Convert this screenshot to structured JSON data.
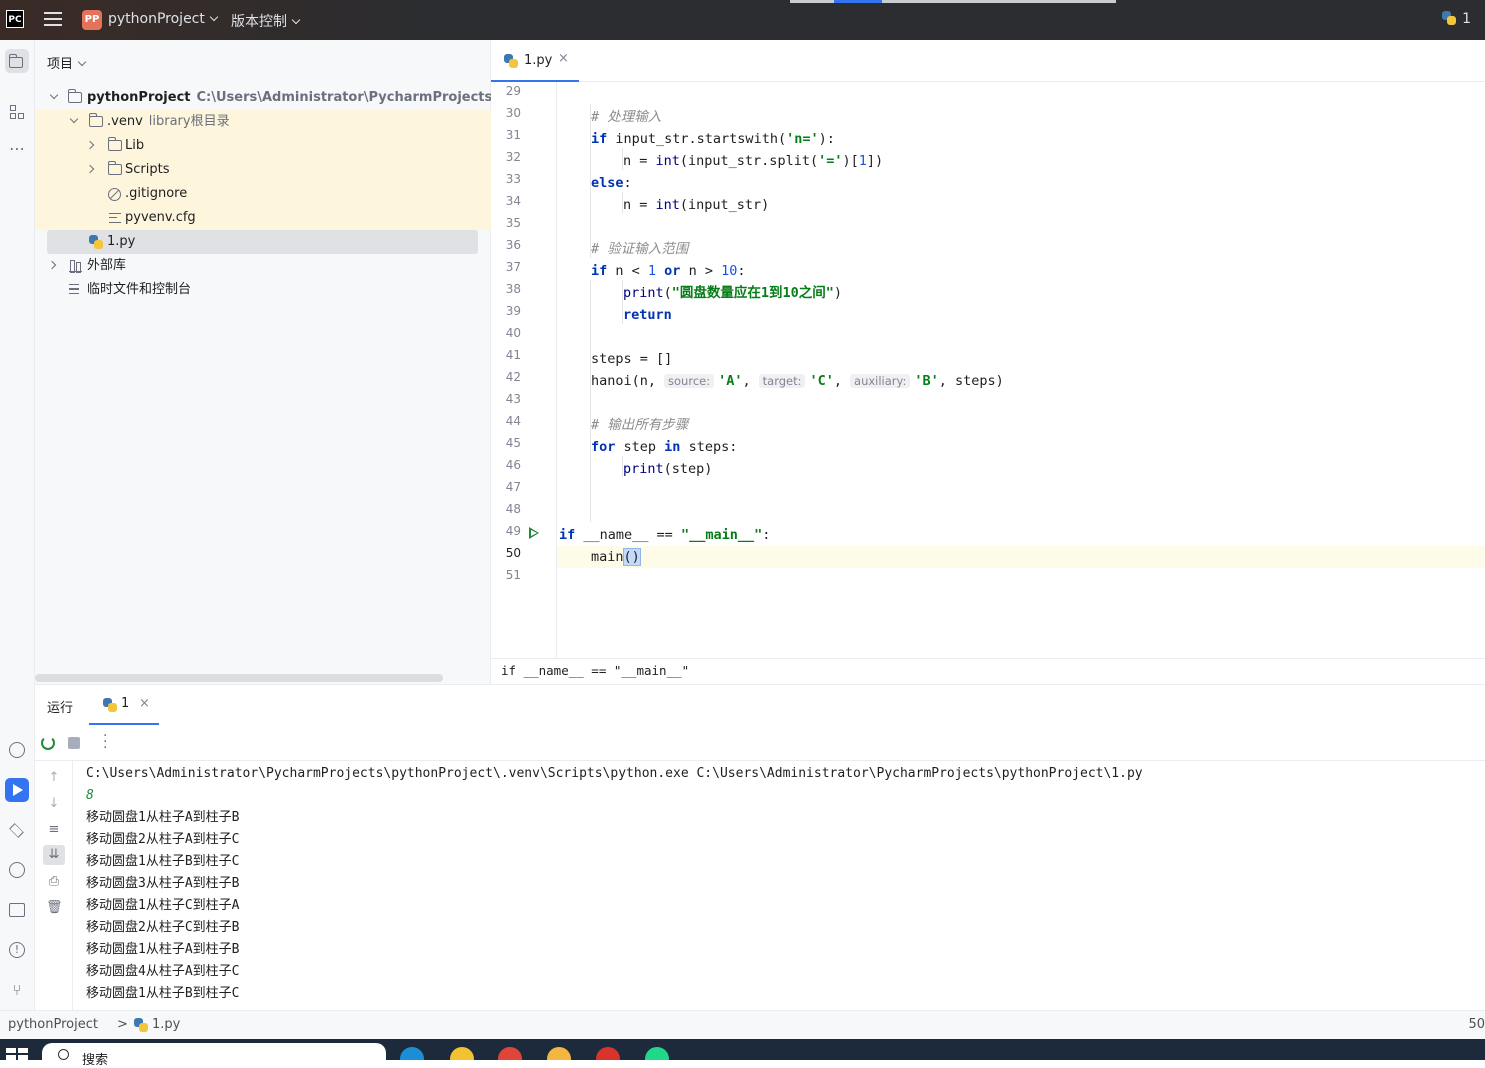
{
  "titlebar": {
    "app_logo": "PC",
    "project_badge": "PP",
    "project_name": "pythonProject",
    "vcs_label": "版本控制",
    "right_indicator": "1",
    "icons": [
      "pycharm-logo-icon",
      "hamburger-menu-icon",
      "chevron-down-icon",
      "python-icon"
    ]
  },
  "project_panel": {
    "title": "项目",
    "tree": [
      {
        "label": "pythonProject",
        "hint": "C:\\Users\\Administrator\\PycharmProjects\\pythonP",
        "icon": "folder-icon",
        "expanded": true
      },
      {
        "label": ".venv",
        "hint": "library根目录",
        "icon": "folder-icon",
        "expanded": true
      },
      {
        "label": "Lib",
        "icon": "folder-icon",
        "expanded": false
      },
      {
        "label": "Scripts",
        "icon": "folder-icon",
        "expanded": false
      },
      {
        "label": ".gitignore",
        "icon": "ignore-file-icon"
      },
      {
        "label": "pyvenv.cfg",
        "icon": "text-file-icon"
      },
      {
        "label": "1.py",
        "icon": "python-file-icon",
        "selected": true
      },
      {
        "label": "外部库",
        "icon": "library-icon",
        "expanded": false
      },
      {
        "label": "临时文件和控制台",
        "icon": "scratches-icon"
      }
    ]
  },
  "editor": {
    "tab": {
      "name": "1.py",
      "close": "×"
    },
    "line_numbers": [
      "29",
      "30",
      "31",
      "32",
      "33",
      "34",
      "35",
      "36",
      "37",
      "38",
      "39",
      "40",
      "41",
      "42",
      "43",
      "44",
      "45",
      "46",
      "47",
      "48",
      "49",
      "50",
      "51"
    ],
    "current_line": "50",
    "code": {
      "l30": "# 处理输入",
      "l31_kw": "if",
      "l31_a": " input_str.startswith(",
      "l31_s": "'n='",
      "l31_b": "):",
      "l32_a": "n = ",
      "l32_fn": "int",
      "l32_b": "(input_str.split(",
      "l32_s": "'='",
      "l32_c": ")[",
      "l32_n": "1",
      "l32_d": "])",
      "l33_kw": "else",
      "l33_b": ":",
      "l34_a": "n = ",
      "l34_fn": "int",
      "l34_b": "(input_str)",
      "l36": "# 验证输入范围",
      "l37_kw": "if",
      "l37_a": " n < ",
      "l37_n1": "1",
      "l37_or": " or",
      "l37_b": " n > ",
      "l37_n2": "10",
      "l37_c": ":",
      "l38_fn": "print",
      "l38_a": "(",
      "l38_s": "\"圆盘数量应在1到10之间\"",
      "l38_b": ")",
      "l39_kw": "return",
      "l41": "steps = []",
      "l42_a": "hanoi(n,",
      "l42_p1": "source:",
      "l42_s1": "'A'",
      "l42_c1": ",",
      "l42_p2": "target:",
      "l42_s2": "'C'",
      "l42_c2": ",",
      "l42_p3": "auxiliary:",
      "l42_s3": "'B'",
      "l42_b": ", steps)",
      "l44": "# 输出所有步骤",
      "l45_kw": "for",
      "l45_a": " step ",
      "l45_in": "in",
      "l45_b": " steps:",
      "l46_fn": "print",
      "l46_a": "(step)",
      "l49_kw": "if",
      "l49_a": " __name__ == ",
      "l49_s": "\"__main__\"",
      "l49_b": ":",
      "l50_a": "main",
      "l50_b": "()"
    },
    "breadcrumb": "if __name__ == \"__main__\""
  },
  "run_panel": {
    "title": "运行",
    "tab": {
      "name": "1",
      "close": "×"
    },
    "console": {
      "command": "C:\\Users\\Administrator\\PycharmProjects\\pythonProject\\.venv\\Scripts\\python.exe C:\\Users\\Administrator\\PycharmProjects\\pythonProject\\1.py",
      "input": "8",
      "lines": [
        "移动圆盘1从柱子A到柱子B",
        "移动圆盘2从柱子A到柱子C",
        "移动圆盘1从柱子B到柱子C",
        "移动圆盘3从柱子A到柱子B",
        "移动圆盘1从柱子C到柱子A",
        "移动圆盘2从柱子C到柱子B",
        "移动圆盘1从柱子A到柱子B",
        "移动圆盘4从柱子A到柱子C",
        "移动圆盘1从柱子B到柱子C"
      ]
    }
  },
  "statusbar": {
    "project": "pythonProject",
    "separator": ">",
    "file": "1.py",
    "position": "50"
  },
  "taskbar": {
    "search_label": "搜索"
  },
  "colors": {
    "accent": "#3574f0",
    "keyword": "#0033b3",
    "string": "#067d17",
    "comment": "#8c8c8c",
    "number": "#1750eb",
    "run_green": "#208a3c",
    "venv_highlight": "#fdf5dc"
  }
}
